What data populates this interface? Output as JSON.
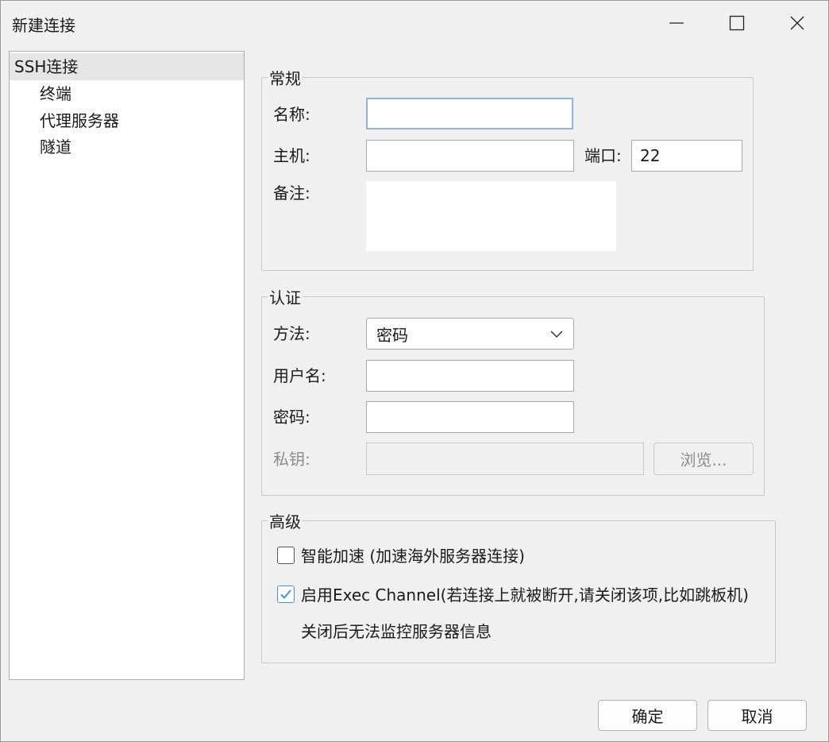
{
  "window": {
    "title": "新建连接",
    "controls": [
      "minimize-icon",
      "maximize-icon",
      "close-icon"
    ]
  },
  "tree": {
    "items": [
      {
        "label": "SSH连接",
        "selected": true
      },
      {
        "label": "终端",
        "selected": false
      },
      {
        "label": "代理服务器",
        "selected": false
      },
      {
        "label": "隧道",
        "selected": false
      }
    ]
  },
  "general": {
    "legend": "常规",
    "name_label": "名称:",
    "name_value": "",
    "host_label": "主机:",
    "host_value": "",
    "port_label": "端口:",
    "port_value": "22",
    "note_label": "备注:",
    "note_value": ""
  },
  "auth": {
    "legend": "认证",
    "method_label": "方法:",
    "method_value": "密码",
    "username_label": "用户名:",
    "username_value": "",
    "password_label": "密码:",
    "password_value": "",
    "key_label": "私钥:",
    "key_value": "",
    "browse_label": "浏览..."
  },
  "advanced": {
    "legend": "高级",
    "smart_accel_label": "智能加速 (加速海外服务器连接)",
    "smart_accel_checked": false,
    "exec_channel_label": "启用Exec Channel(若连接上就被断开,请关闭该项,比如跳板机)",
    "exec_channel_checked": true,
    "exec_channel_note": "关闭后无法监控服务器信息"
  },
  "footer": {
    "ok_label": "确定",
    "cancel_label": "取消"
  },
  "colors": {
    "background": "#f0f0f0",
    "focus_border": "#8fb4d9",
    "check_accent": "#4a8fd6",
    "selected_item": "#e5e5e5"
  }
}
